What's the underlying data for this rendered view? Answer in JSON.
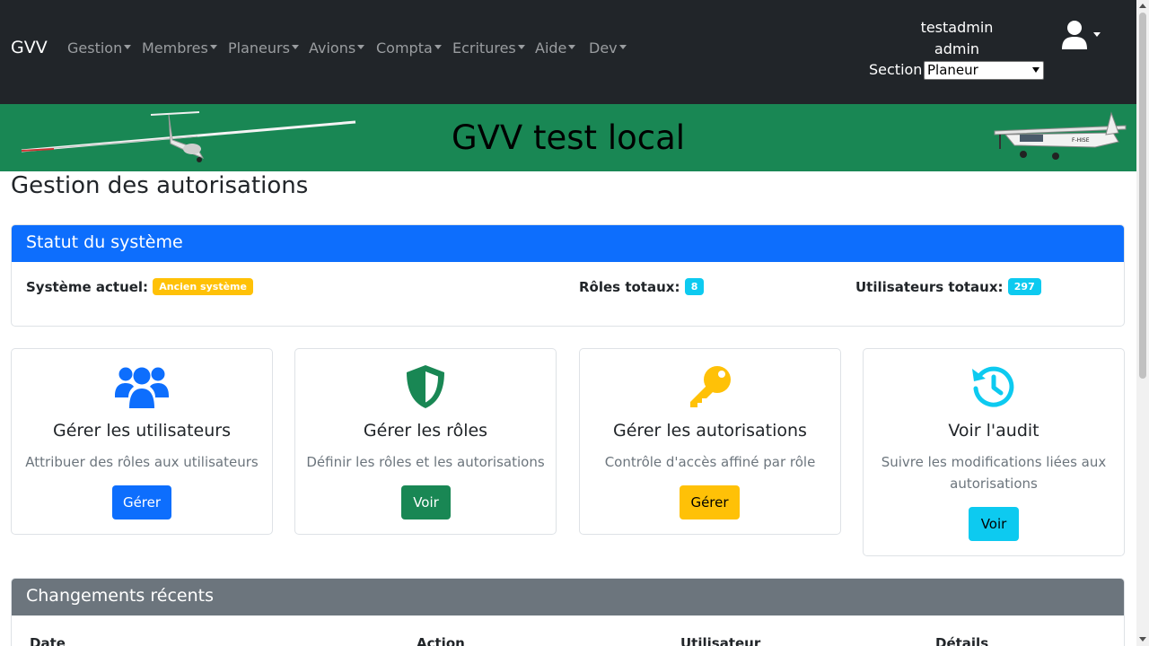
{
  "navbar": {
    "brand": "GVV",
    "menus": [
      {
        "label": "Gestion"
      },
      {
        "label": "Membres"
      },
      {
        "label": "Planeurs"
      },
      {
        "label": "Avions"
      },
      {
        "label": "Compta"
      },
      {
        "label": "Ecritures"
      },
      {
        "label": "Aide"
      },
      {
        "label": "Dev"
      }
    ],
    "user": {
      "name": "testadmin",
      "role": "admin"
    },
    "section": {
      "label": "Section:",
      "selected": "Planeur"
    },
    "icons": {
      "user": "user-icon",
      "caret": "caret-down-icon"
    }
  },
  "banner": {
    "title": "GVV test local",
    "left_image": "glider-image",
    "right_image": "cessna-aircraft-image",
    "right_image_registration": "F-HISE"
  },
  "page": {
    "title": "Gestion des autorisations"
  },
  "status": {
    "header": "Statut du système",
    "current_system_label": "Système actuel:",
    "current_system_value": "Ancien système",
    "roles_label": "Rôles totaux:",
    "roles_value": "8",
    "users_label": "Utilisateurs totaux:",
    "users_value": "297"
  },
  "actions": [
    {
      "icon": "users-icon",
      "title": "Gérer les utilisateurs",
      "description": "Attribuer des rôles aux utilisateurs",
      "button": "Gérer",
      "color": "#0d6efd"
    },
    {
      "icon": "shield-icon",
      "title": "Gérer les rôles",
      "description": "Définir les rôles et les autorisations",
      "button": "Voir",
      "color": "#198754"
    },
    {
      "icon": "key-icon",
      "title": "Gérer les autorisations",
      "description": "Contrôle d'accès affiné par rôle",
      "button": "Gérer",
      "color": "#ffc107"
    },
    {
      "icon": "history-icon",
      "title": "Voir l'audit",
      "description": "Suivre les modifications liées aux autorisations",
      "button": "Voir",
      "color": "#0dcaf0"
    }
  ],
  "recent": {
    "header": "Changements récents",
    "columns": [
      "Date",
      "Action",
      "Utilisateur",
      "Détails"
    ]
  },
  "colors": {
    "navbar": "#212529",
    "banner": "#198754",
    "primary": "#0d6efd",
    "secondary": "#6c757d"
  }
}
